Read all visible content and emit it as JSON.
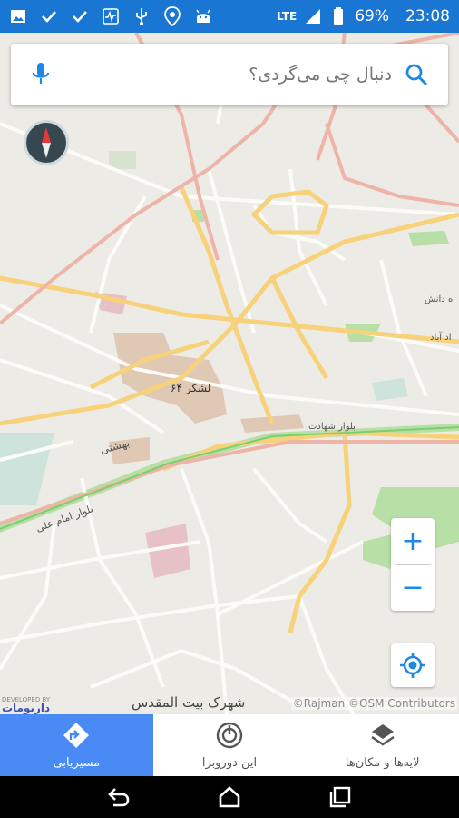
{
  "status_bar": {
    "battery": "69%",
    "time": "23:08",
    "network": "LTE",
    "left_icons": [
      "image-icon",
      "check-icon",
      "check-icon",
      "activity-icon",
      "usb-icon",
      "location-pin-icon",
      "android-icon"
    ]
  },
  "search": {
    "placeholder": "دنبال چی می‌گردی؟",
    "left_icon": "mic-icon",
    "right_icon": "search-icon"
  },
  "map": {
    "labels": {
      "lashkar": "لشکر ۶۴",
      "imam_ali": "بلوار امام علی",
      "beheshti": "بهشتی",
      "shahrak": "شهرک بیت المقدس",
      "shahadat": "بلوار شهادت",
      "daneshgah": "ه دانش",
      "abad": "اد آباد"
    },
    "zoom_in": "+",
    "zoom_out": "−",
    "attribution": "©Rajman ©OSM Contributors",
    "developer": "DEVELOPED BY",
    "developer_logo": "داریومات"
  },
  "bottom_nav": {
    "items": [
      {
        "label": "مسیریابی",
        "icon": "directions-icon",
        "active": true
      },
      {
        "label": "این دوروبرا",
        "icon": "nearby-icon",
        "active": false
      },
      {
        "label": "لایه‌ها و مکان‌ها",
        "icon": "layers-icon",
        "active": false
      }
    ]
  },
  "colors": {
    "status_bar": "#1976d2",
    "accent": "#4a8af4",
    "primary_road": "#f7d27a",
    "major_road": "#efb4a8",
    "green": "#b7dfa6"
  }
}
